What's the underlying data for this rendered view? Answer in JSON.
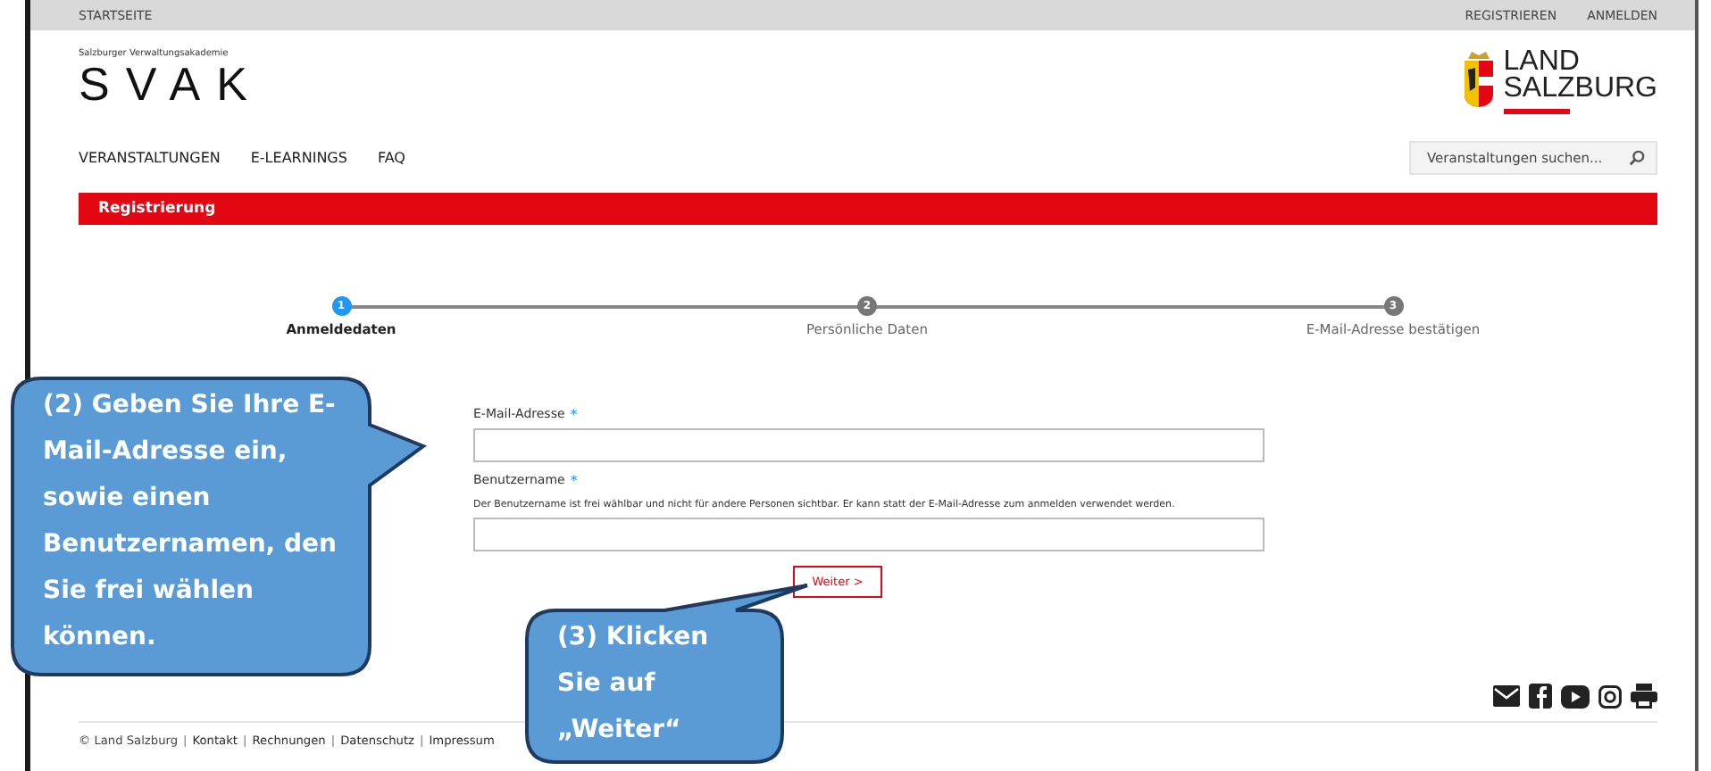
{
  "top_bar": {
    "left": [
      {
        "label": "STARTSEITE"
      }
    ],
    "right": [
      {
        "label": "REGISTRIEREN"
      },
      {
        "label": "ANMELDEN"
      }
    ]
  },
  "logo": {
    "tagline": "Salzburger Verwaltungsakademie",
    "name": "SVAK"
  },
  "partner_logo": {
    "line_1": "LAND",
    "line_2": "SALZBURG"
  },
  "nav": [
    {
      "label": "VERANSTALTUNGEN"
    },
    {
      "label": "E-LEARNINGS"
    },
    {
      "label": "FAQ"
    }
  ],
  "search": {
    "placeholder": "Veranstaltungen suchen..."
  },
  "section_title": "Registrierung",
  "steps": [
    {
      "number": "1",
      "label": "Anmeldedaten",
      "selected": true
    },
    {
      "number": "2",
      "label": "Persönliche Daten",
      "selected": false
    },
    {
      "number": "3",
      "label": "E-Mail-Adresse bestätigen",
      "selected": false
    }
  ],
  "form": {
    "fields": [
      {
        "label": "E-Mail-Adresse",
        "required_mark": "*"
      },
      {
        "label": "Benutzername",
        "required_mark": "*",
        "help": "Der Benutzername ist frei wählbar und nicht für andere Personen sichtbar. Er kann statt der E-Mail-Adresse zum anmelden verwendet werden."
      }
    ],
    "submit": "Weiter >"
  },
  "footer": {
    "items": [
      {
        "text": "© Land Salzburg",
        "kind": "text"
      },
      {
        "text": "|",
        "kind": "separator"
      },
      {
        "text": "Kontakt",
        "kind": "link"
      },
      {
        "text": "|",
        "kind": "separator"
      },
      {
        "text": "Rechnungen",
        "kind": "link"
      },
      {
        "text": "|",
        "kind": "separator"
      },
      {
        "text": "Datenschutz",
        "kind": "link"
      },
      {
        "text": "|",
        "kind": "separator"
      },
      {
        "text": "Impressum",
        "kind": "link"
      }
    ]
  },
  "callouts": [
    {
      "text": "(2) Geben Sie Ihre E-Mail-Adresse ein, sowie einen Benutzernamen, den Sie frei wählen können.",
      "kind": "left"
    },
    {
      "text": "(3) Klicken Sie auf „Weiter“",
      "kind": "bottom"
    }
  ]
}
